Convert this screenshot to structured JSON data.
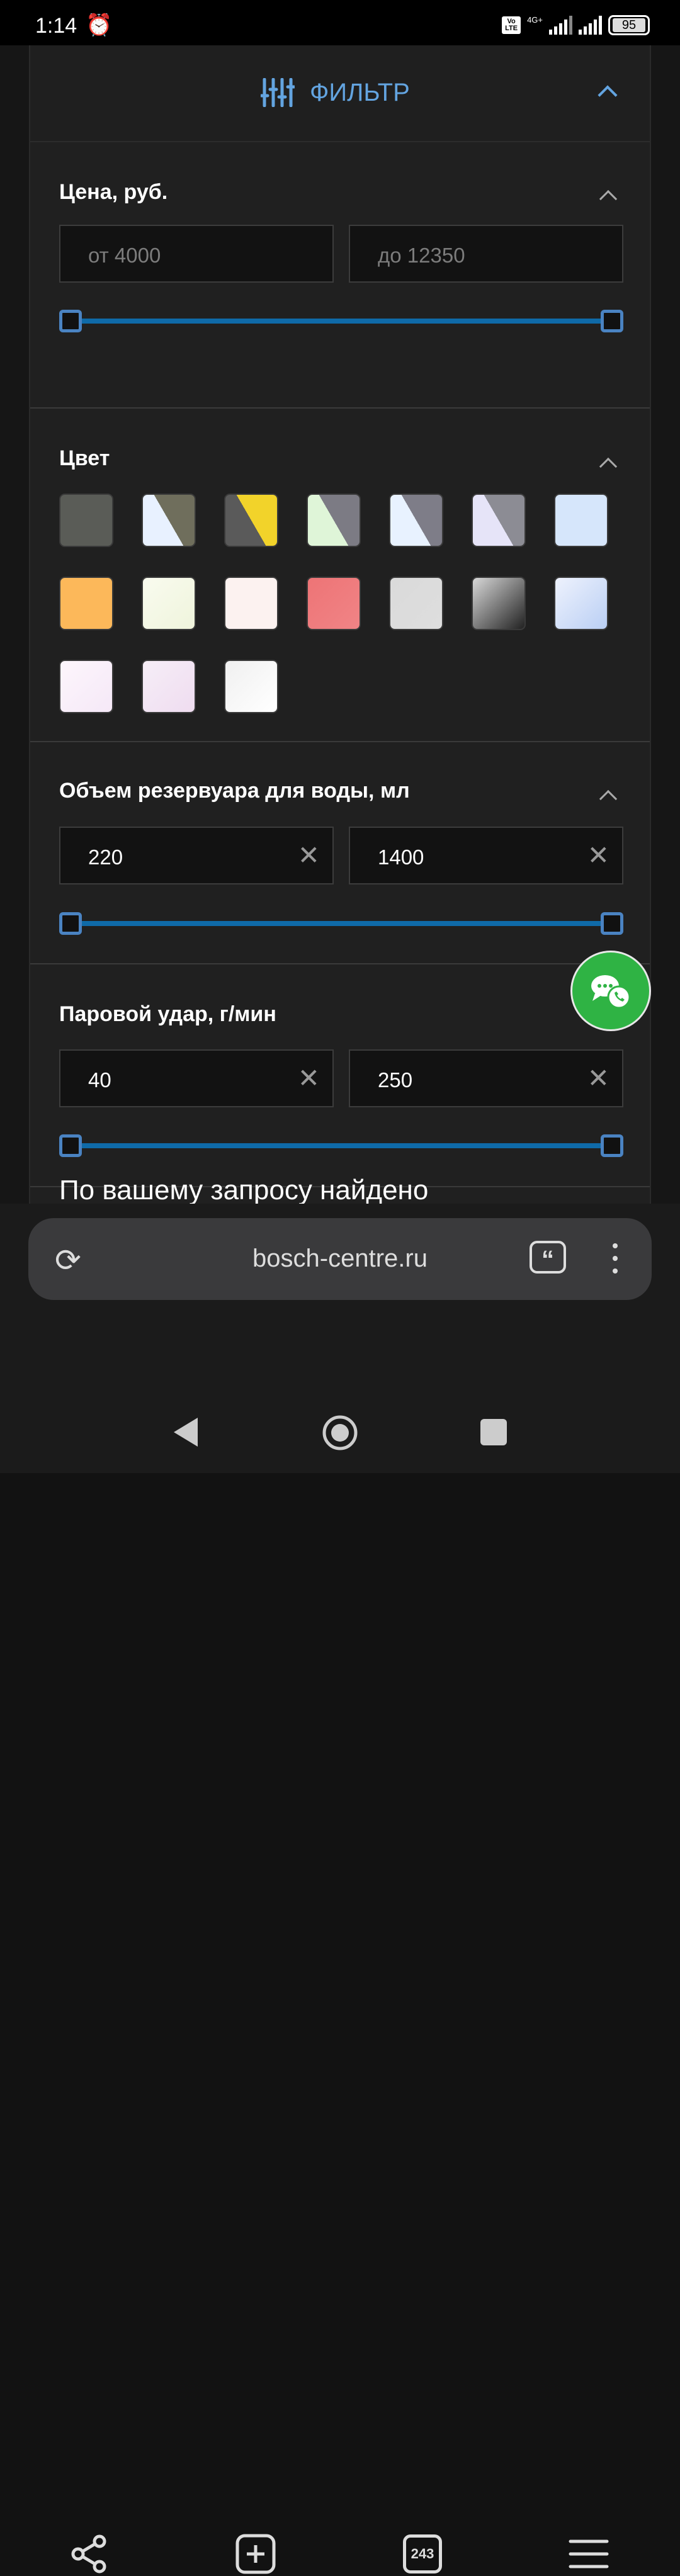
{
  "status": {
    "time": "1:14",
    "volte": "Vo LTE",
    "network": "4G+",
    "battery": "95"
  },
  "filter": {
    "title": "ФИЛЬТР",
    "price": {
      "title": "Цена, руб.",
      "from_placeholder": "от 4000",
      "to_placeholder": "до 12350",
      "range_fraction": [
        0,
        1
      ]
    },
    "color": {
      "title": "Цвет",
      "swatches": [
        [
          "#5a5c57",
          "#5a5c57"
        ],
        [
          "#e8f1ff",
          "#6f6e5c"
        ],
        [
          "#5a5a5a",
          "#f2d32a"
        ],
        [
          "#dff5d8",
          "#7c7b84"
        ],
        [
          "#e8f2ff",
          "#7e7d88"
        ],
        [
          "#e6e4f8",
          "#8c8c94"
        ],
        [
          "#d6e6fb",
          "#d6e6fb"
        ],
        [
          "#fcb85a",
          "#fcb85a"
        ],
        [
          "#f9fbef",
          "#eff4dc"
        ],
        [
          "#fcf2f0",
          "#fcf2f0"
        ],
        [
          "#ee7476",
          "#f08486"
        ],
        [
          "#dadada",
          "#dedede"
        ],
        [
          "#d8d8d8",
          "#222222"
        ],
        [
          "#eef2fd",
          "#bacff4"
        ],
        [
          "#fdf6fc",
          "#f5e8f7"
        ],
        [
          "#f6eef7",
          "#efdcf0"
        ],
        [
          "#f0f0f0",
          "#ffffff"
        ]
      ]
    },
    "water": {
      "title": "Объем резервуара для воды, мл",
      "from": "220",
      "to": "1400",
      "range_fraction": [
        0,
        1
      ]
    },
    "steam": {
      "title": "Паровой удар, г/мин",
      "from": "40",
      "to": "250",
      "range_fraction": [
        0,
        1
      ]
    },
    "result_text": "По вашему запросу найдено"
  },
  "browser": {
    "url": "bosch-centre.ru",
    "tabs_count": "243"
  }
}
